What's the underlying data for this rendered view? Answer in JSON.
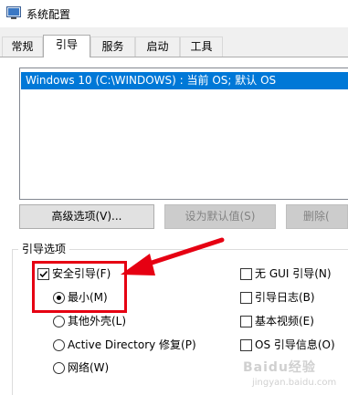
{
  "window": {
    "title": "系统配置"
  },
  "tabs": [
    {
      "label": "常规",
      "active": false
    },
    {
      "label": "引导",
      "active": true
    },
    {
      "label": "服务",
      "active": false
    },
    {
      "label": "启动",
      "active": false
    },
    {
      "label": "工具",
      "active": false
    }
  ],
  "os_list": {
    "items": [
      "Windows 10 (C:\\WINDOWS) : 当前 OS; 默认 OS"
    ],
    "selected_index": 0
  },
  "buttons": {
    "advanced": "高级选项(V)...",
    "set_default": "设为默认值(S)",
    "delete": "删除("
  },
  "boot_options": {
    "group_label": "引导选项",
    "safe_boot": {
      "label": "安全引导(F)",
      "checked": true
    },
    "minimal": {
      "label": "最小(M)",
      "selected": true
    },
    "alternate_shell": {
      "label": "其他外壳(L)",
      "selected": false
    },
    "active_directory": {
      "label": "Active Directory 修复(P)",
      "selected": false
    },
    "network": {
      "label": "网络(W)",
      "selected": false
    },
    "no_gui": {
      "label": "无 GUI 引导(N)",
      "checked": false
    },
    "boot_log": {
      "label": "引导日志(B)",
      "checked": false
    },
    "base_video": {
      "label": "基本视频(E)",
      "checked": false
    },
    "os_boot_info": {
      "label": "OS 引导信息(O)",
      "checked": false
    }
  },
  "annotation": {
    "color": "#e60012"
  },
  "watermark": {
    "text": "Baidu经验",
    "sub": "jingyan.baidu.com"
  },
  "colors": {
    "selection": "#0078d7",
    "accent_red": "#e60012"
  }
}
